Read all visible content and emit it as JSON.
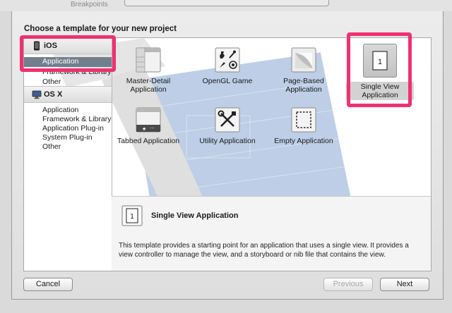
{
  "topbar": {
    "breakpoints_label": "Breakpoints"
  },
  "dialog": {
    "heading": "Choose a template for your new project"
  },
  "sidebar": {
    "ios": {
      "label": "iOS",
      "items": [
        "Application",
        "Framework & Library",
        "Other"
      ]
    },
    "osx": {
      "label": "OS X",
      "items": [
        "Application",
        "Framework & Library",
        "Application Plug-in",
        "System Plug-in",
        "Other"
      ]
    }
  },
  "templates": [
    {
      "name": "Master-Detail Application",
      "icon": "master-detail-icon"
    },
    {
      "name": "OpenGL Game",
      "icon": "opengl-game-icon"
    },
    {
      "name": "Page-Based Application",
      "icon": "page-based-icon"
    },
    {
      "name": "Single View Application",
      "icon": "single-view-icon",
      "selected": true
    },
    {
      "name": "Tabbed Application",
      "icon": "tabbed-icon"
    },
    {
      "name": "Utility Application",
      "icon": "utility-icon"
    },
    {
      "name": "Empty Application",
      "icon": "empty-icon"
    }
  ],
  "description": {
    "title": "Single View Application",
    "text": "This template provides a starting point for an application that uses a single view. It provides a view controller to manage the view, and a storyboard or nib file that contains the view."
  },
  "buttons": {
    "cancel": "Cancel",
    "previous": "Previous",
    "next": "Next"
  },
  "colors": {
    "highlight": "#f0316f",
    "selection": "#737e8c"
  }
}
